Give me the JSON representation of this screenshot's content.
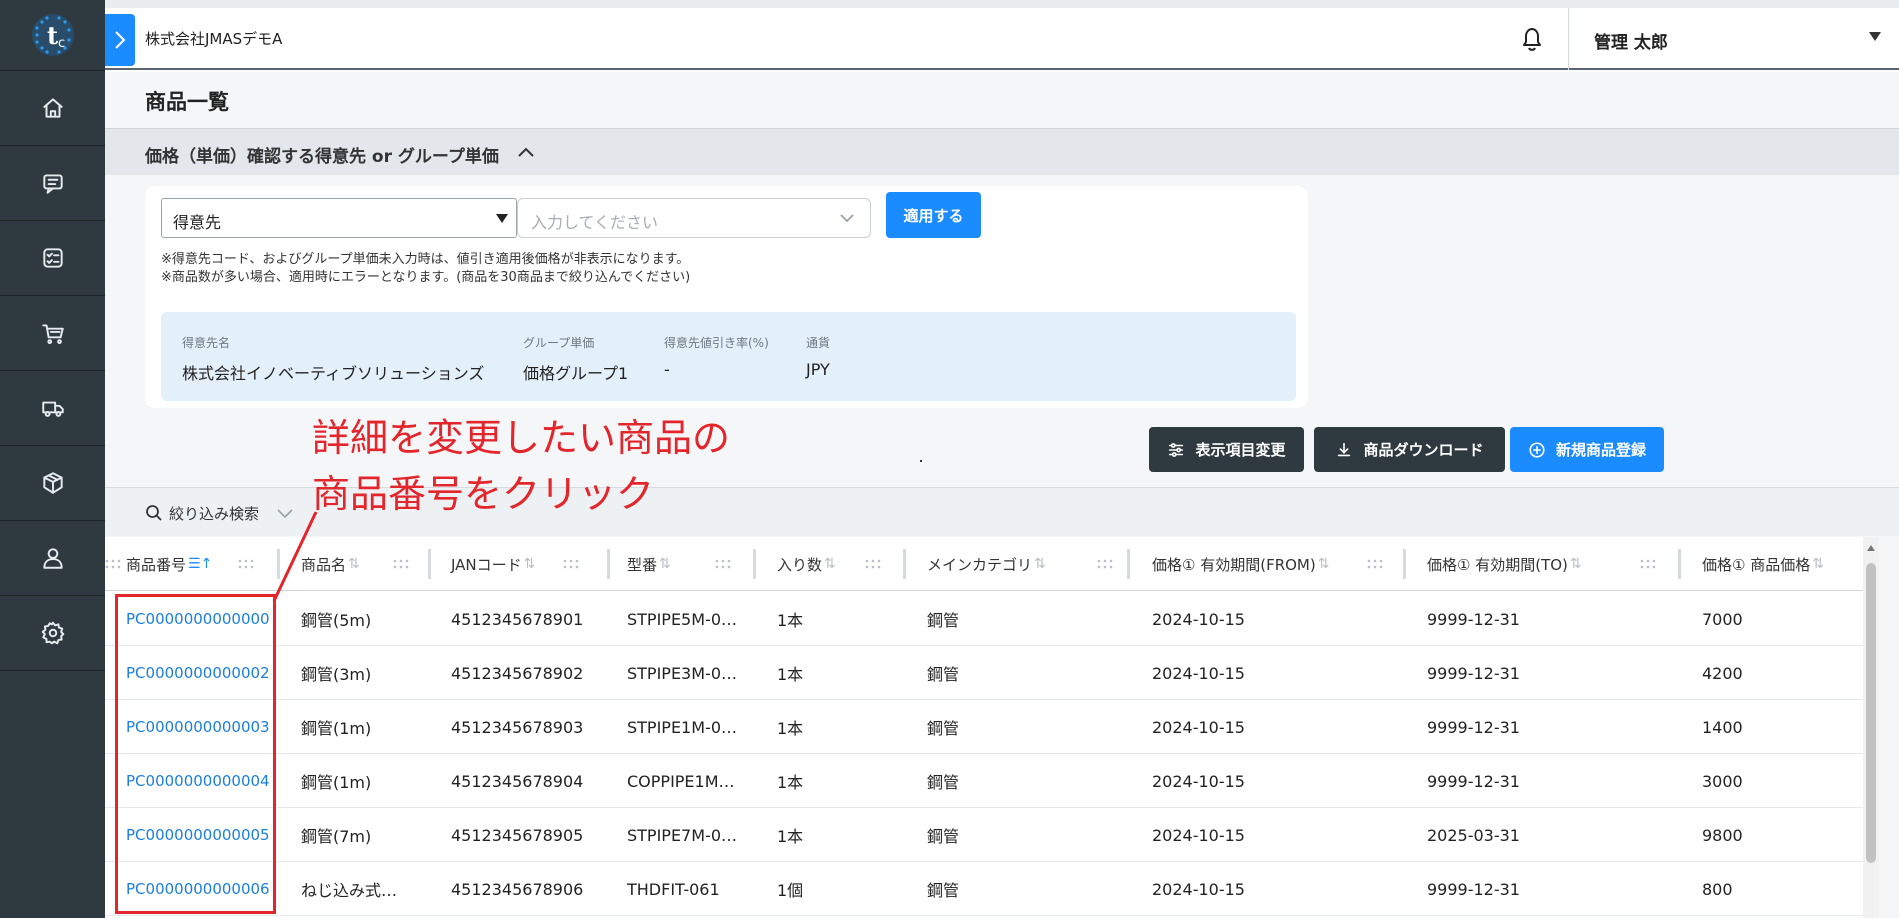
{
  "app": {
    "logo_icon": "brand-logo-icon"
  },
  "sidebar": {
    "items": [
      {
        "name": "home",
        "icon": "home-icon"
      },
      {
        "name": "messages",
        "icon": "chat-icon"
      },
      {
        "name": "tasks",
        "icon": "checklist-icon"
      },
      {
        "name": "cart",
        "icon": "cart-icon"
      },
      {
        "name": "shipping",
        "icon": "truck-icon"
      },
      {
        "name": "products",
        "icon": "box-icon"
      },
      {
        "name": "users",
        "icon": "user-icon"
      },
      {
        "name": "settings",
        "icon": "gear-icon"
      }
    ]
  },
  "header": {
    "company": "株式会社JMASデモA",
    "user_name": "管理 太郎"
  },
  "page": {
    "title": "商品一覧",
    "section_title": "価格（単価）確認する得意先 or グループ単価"
  },
  "filter": {
    "type_value": "得意先",
    "input_placeholder": "入力してください",
    "apply_label": "適用する",
    "note1": "※得意先コード、およびグループ単価未入力時は、値引き適用後価格が非表示になります。",
    "note2": "※商品数が多い場合、適用時にエラーとなります。(商品を30商品まで絞り込んでください)"
  },
  "info": {
    "customer_label": "得意先名",
    "customer_value": "株式会社イノベーティブソリューションズ",
    "group_label": "グループ単価",
    "group_value": "価格グループ1",
    "discount_label": "得意先値引き率(%)",
    "discount_value": "-",
    "currency_label": "通貨",
    "currency_value": "JPY"
  },
  "actions": {
    "columns_label": "表示項目変更",
    "download_label": "商品ダウンロード",
    "new_label": "新規商品登録"
  },
  "search": {
    "toggle_label": "絞り込み検索"
  },
  "annotation": {
    "line1": "詳細を変更したい商品の",
    "line2": "商品番号をクリック"
  },
  "table": {
    "columns": [
      {
        "label": "商品番号",
        "sort": "⇅"
      },
      {
        "label": "商品名",
        "sort": "⇅"
      },
      {
        "label": "JANコード",
        "sort": "⇅"
      },
      {
        "label": "型番",
        "sort": "⇅"
      },
      {
        "label": "入り数",
        "sort": "⇅"
      },
      {
        "label": "メインカテゴリ",
        "sort": "⇅"
      },
      {
        "label": "価格① 有効期間(FROM)",
        "sort": "⇅"
      },
      {
        "label": "価格① 有効期間(TO)",
        "sort": "⇅"
      },
      {
        "label": "価格① 商品価格",
        "sort": "⇅"
      }
    ],
    "rows": [
      [
        "PC0000000000000",
        "鋼管(5m)",
        "4512345678901",
        "STPIPE5M-0…",
        "1本",
        "鋼管",
        "2024-10-15",
        "9999-12-31",
        "7000"
      ],
      [
        "PC0000000000002",
        "鋼管(3m)",
        "4512345678902",
        "STPIPE3M-0…",
        "1本",
        "鋼管",
        "2024-10-15",
        "9999-12-31",
        "4200"
      ],
      [
        "PC0000000000003",
        "鋼管(1m)",
        "4512345678903",
        "STPIPE1M-0…",
        "1本",
        "鋼管",
        "2024-10-15",
        "9999-12-31",
        "1400"
      ],
      [
        "PC0000000000004",
        "鋼管(1m)",
        "4512345678904",
        "COPPIPE1M…",
        "1本",
        "鋼管",
        "2024-10-15",
        "9999-12-31",
        "3000"
      ],
      [
        "PC0000000000005",
        "鋼管(7m)",
        "4512345678905",
        "STPIPE7M-0…",
        "1本",
        "鋼管",
        "2024-10-15",
        "2025-03-31",
        "9800"
      ],
      [
        "PC0000000000006",
        "ねじ込み式…",
        "4512345678906",
        "THDFIT-061",
        "1個",
        "鋼管",
        "2024-10-15",
        "9999-12-31",
        "800"
      ]
    ]
  },
  "colors": {
    "accent": "#1a8cff",
    "sidebar": "#2f3a40",
    "annotation": "#e3252c",
    "link": "#1a7fdc"
  }
}
